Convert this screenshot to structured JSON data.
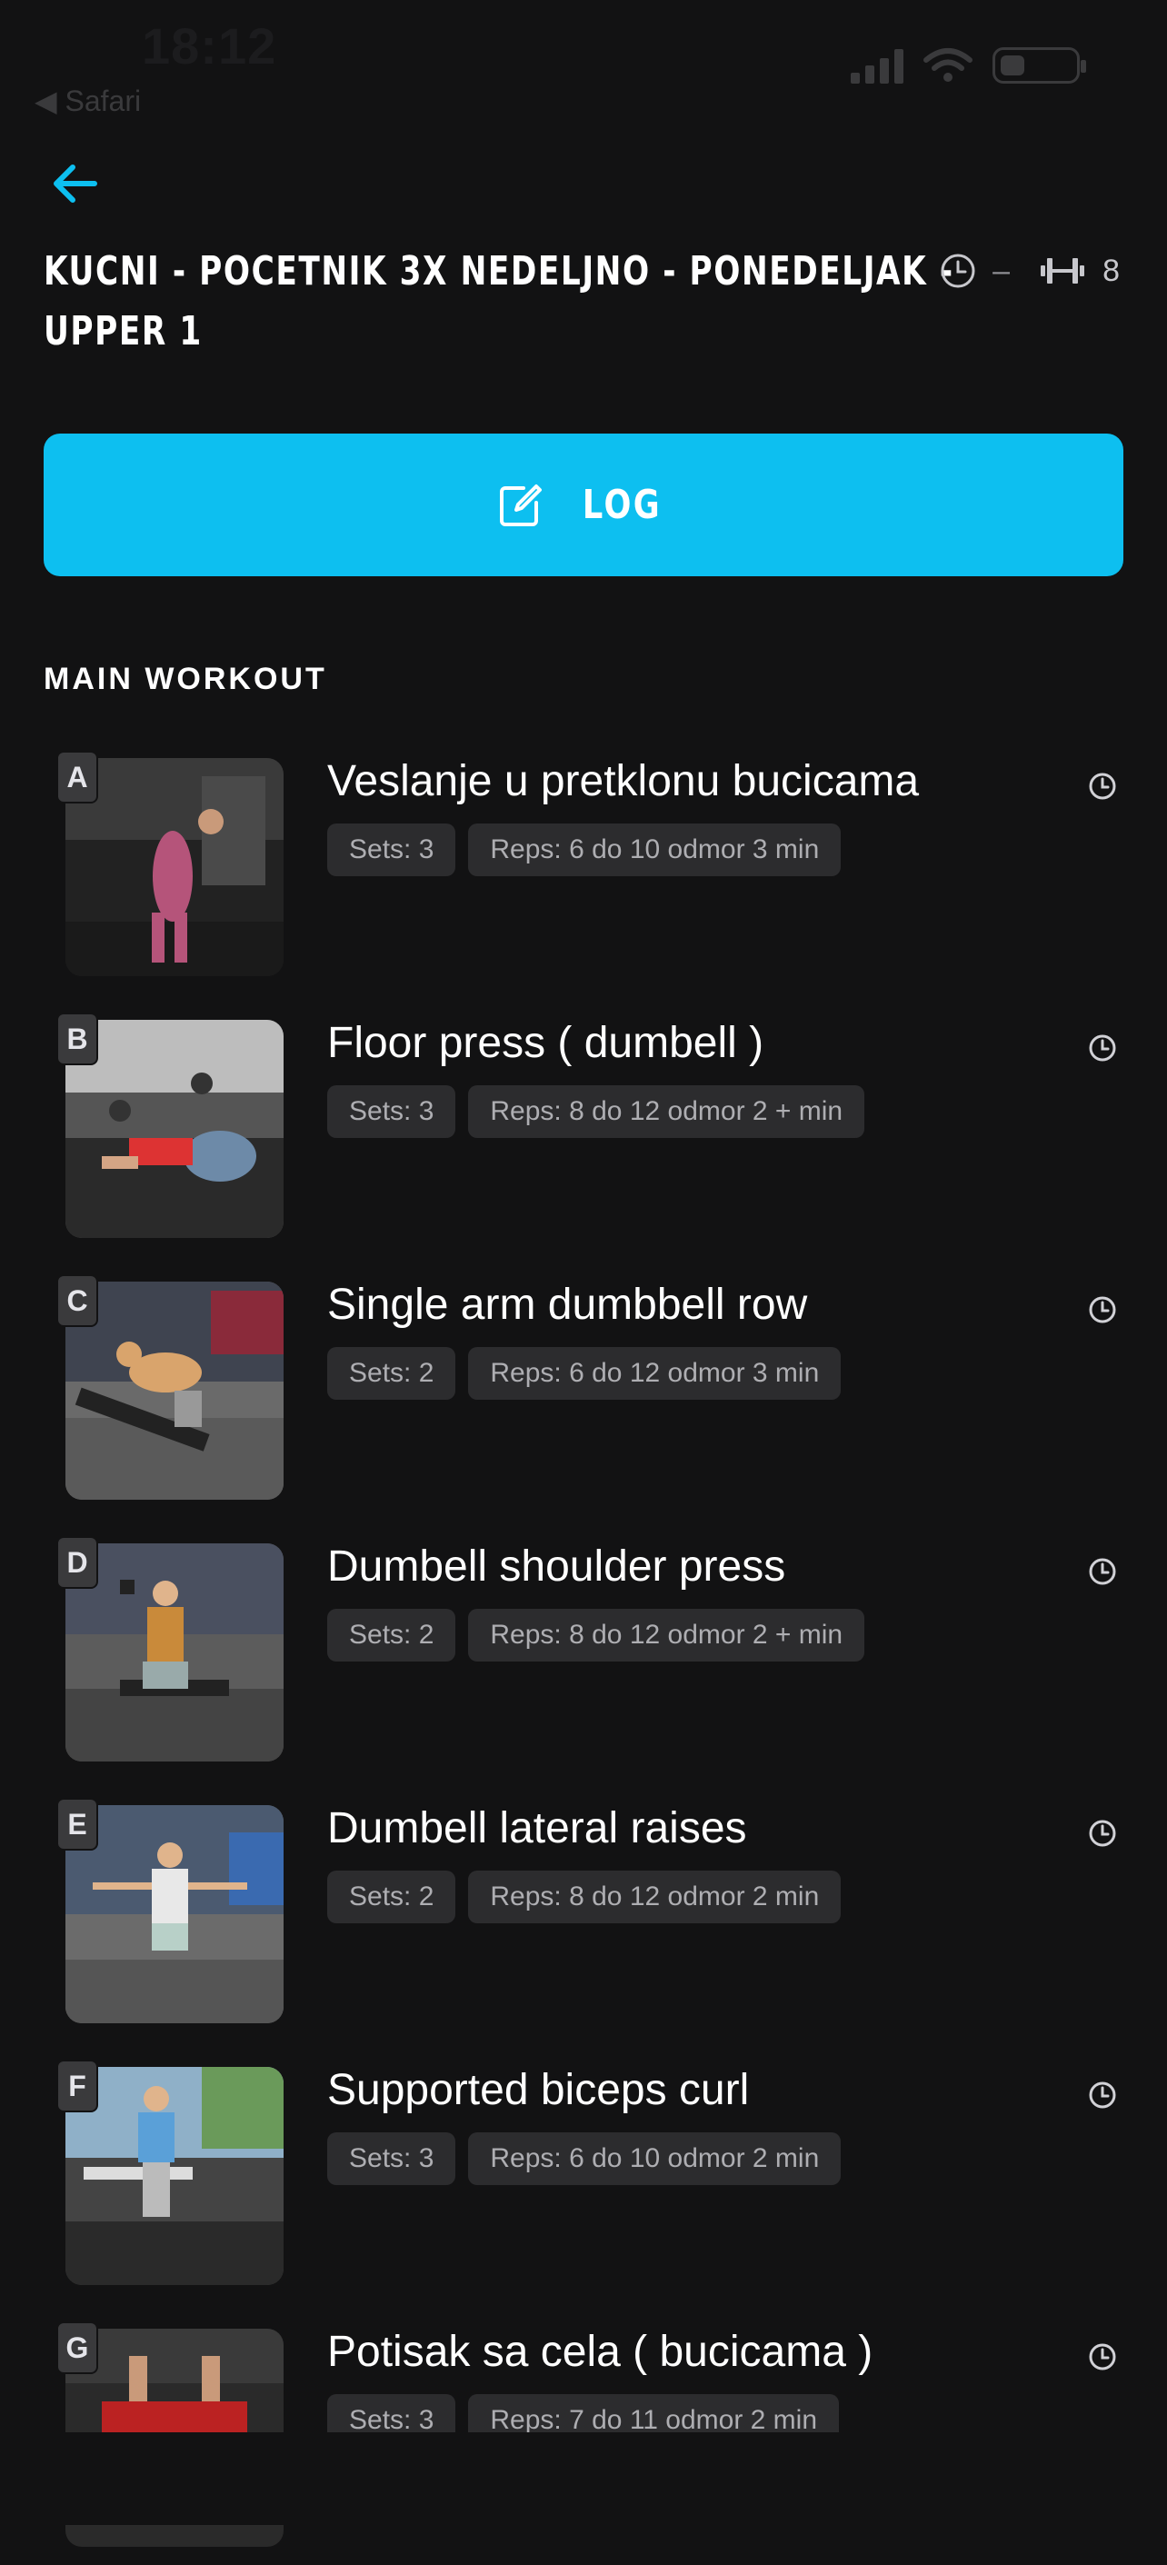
{
  "status_bar": {
    "time": "18:12",
    "back_app": "◀ Safari"
  },
  "header": {
    "title_line1": "KUCNI - POCETNIK 3X NEDELJNO - PONEDELJAK -",
    "title_line2": "UPPER 1",
    "duration": "–",
    "exercise_count": "8"
  },
  "log_button": {
    "label": "LOG"
  },
  "section": {
    "title": "MAIN WORKOUT"
  },
  "exercises": [
    {
      "letter": "A",
      "name": "Veslanje u pretklonu bucicama",
      "sets": "Sets: 3",
      "reps": "Reps: 6 do 10 odmor 3 min"
    },
    {
      "letter": "B",
      "name": "Floor press ( dumbell )",
      "sets": "Sets: 3",
      "reps": "Reps: 8 do 12 odmor 2 + min"
    },
    {
      "letter": "C",
      "name": "Single arm dumbbell row",
      "sets": "Sets: 2",
      "reps": "Reps: 6 do 12 odmor 3 min"
    },
    {
      "letter": "D",
      "name": "Dumbell shoulder press",
      "sets": "Sets: 2",
      "reps": "Reps: 8 do 12 odmor 2 + min"
    },
    {
      "letter": "E",
      "name": "Dumbell lateral raises",
      "sets": "Sets: 2",
      "reps": "Reps: 8 do 12 odmor 2 min"
    },
    {
      "letter": "F",
      "name": "Supported biceps curl",
      "sets": "Sets: 3",
      "reps": "Reps:  6 do 10 odmor 2 min"
    },
    {
      "letter": "G",
      "name": "Potisak sa cela ( bucicama )",
      "sets": "Sets: 3",
      "reps": "Reps: 7 do 11 odmor 2 min"
    }
  ],
  "colors": {
    "accent": "#0dbff0",
    "background": "#121213",
    "tag_bg": "#2c2c2e"
  }
}
